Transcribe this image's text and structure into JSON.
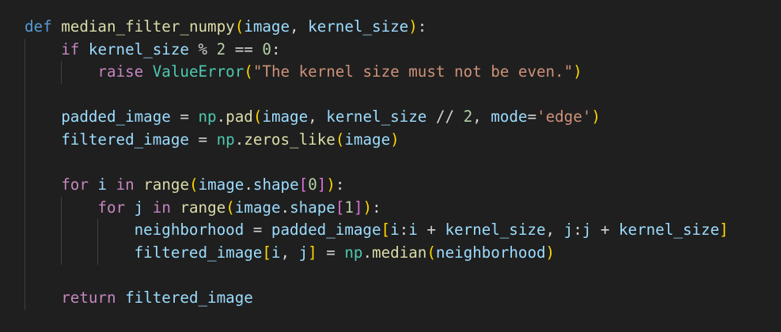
{
  "editor": {
    "language": "python",
    "theme_colors": {
      "background": "#1f1f1f",
      "keyword_def": "#569cd6",
      "keyword_control": "#c586c0",
      "function": "#dcdcaa",
      "variable": "#9cdcfe",
      "module": "#4ec9b0",
      "number": "#b5cea8",
      "string": "#ce9178",
      "bracket_level1": "#ffd700",
      "bracket_level2": "#da70d6",
      "bracket_level3": "#179fff"
    },
    "lines": [
      [
        {
          "t": "def",
          "c": "kw-def"
        },
        {
          "t": " ",
          "c": "op"
        },
        {
          "t": "median_filter_numpy",
          "c": "fn"
        },
        {
          "t": "(",
          "c": "b1"
        },
        {
          "t": "image",
          "c": "var"
        },
        {
          "t": ", ",
          "c": "op"
        },
        {
          "t": "kernel_size",
          "c": "var"
        },
        {
          "t": ")",
          "c": "b1"
        },
        {
          "t": ":",
          "c": "op"
        }
      ],
      [
        {
          "t": "    ",
          "c": "op"
        },
        {
          "t": "if",
          "c": "kw-ctl"
        },
        {
          "t": " ",
          "c": "op"
        },
        {
          "t": "kernel_size",
          "c": "var"
        },
        {
          "t": " % ",
          "c": "op"
        },
        {
          "t": "2",
          "c": "num"
        },
        {
          "t": " == ",
          "c": "op"
        },
        {
          "t": "0",
          "c": "num"
        },
        {
          "t": ":",
          "c": "op"
        }
      ],
      [
        {
          "t": "        ",
          "c": "op"
        },
        {
          "t": "raise",
          "c": "kw-ctl"
        },
        {
          "t": " ",
          "c": "op"
        },
        {
          "t": "ValueError",
          "c": "cls"
        },
        {
          "t": "(",
          "c": "b1"
        },
        {
          "t": "\"The kernel size must not be even.\"",
          "c": "str"
        },
        {
          "t": ")",
          "c": "b1"
        }
      ],
      [],
      [
        {
          "t": "    ",
          "c": "op"
        },
        {
          "t": "padded_image",
          "c": "var"
        },
        {
          "t": " = ",
          "c": "op"
        },
        {
          "t": "np",
          "c": "mod"
        },
        {
          "t": ".",
          "c": "op"
        },
        {
          "t": "pad",
          "c": "fn"
        },
        {
          "t": "(",
          "c": "b1"
        },
        {
          "t": "image",
          "c": "var"
        },
        {
          "t": ", ",
          "c": "op"
        },
        {
          "t": "kernel_size",
          "c": "var"
        },
        {
          "t": " // ",
          "c": "op"
        },
        {
          "t": "2",
          "c": "num"
        },
        {
          "t": ", ",
          "c": "op"
        },
        {
          "t": "mode",
          "c": "var"
        },
        {
          "t": "=",
          "c": "op"
        },
        {
          "t": "'edge'",
          "c": "str"
        },
        {
          "t": ")",
          "c": "b1"
        }
      ],
      [
        {
          "t": "    ",
          "c": "op"
        },
        {
          "t": "filtered_image",
          "c": "var"
        },
        {
          "t": " = ",
          "c": "op"
        },
        {
          "t": "np",
          "c": "mod"
        },
        {
          "t": ".",
          "c": "op"
        },
        {
          "t": "zeros_like",
          "c": "fn"
        },
        {
          "t": "(",
          "c": "b1"
        },
        {
          "t": "image",
          "c": "var"
        },
        {
          "t": ")",
          "c": "b1"
        }
      ],
      [],
      [
        {
          "t": "    ",
          "c": "op"
        },
        {
          "t": "for",
          "c": "kw-ctl"
        },
        {
          "t": " ",
          "c": "op"
        },
        {
          "t": "i",
          "c": "var"
        },
        {
          "t": " ",
          "c": "op"
        },
        {
          "t": "in",
          "c": "kw-ctl"
        },
        {
          "t": " ",
          "c": "op"
        },
        {
          "t": "range",
          "c": "fn"
        },
        {
          "t": "(",
          "c": "b1"
        },
        {
          "t": "image",
          "c": "var"
        },
        {
          "t": ".",
          "c": "op"
        },
        {
          "t": "shape",
          "c": "var"
        },
        {
          "t": "[",
          "c": "b2"
        },
        {
          "t": "0",
          "c": "num"
        },
        {
          "t": "]",
          "c": "b2"
        },
        {
          "t": ")",
          "c": "b1"
        },
        {
          "t": ":",
          "c": "op"
        }
      ],
      [
        {
          "t": "        ",
          "c": "op"
        },
        {
          "t": "for",
          "c": "kw-ctl"
        },
        {
          "t": " ",
          "c": "op"
        },
        {
          "t": "j",
          "c": "var"
        },
        {
          "t": " ",
          "c": "op"
        },
        {
          "t": "in",
          "c": "kw-ctl"
        },
        {
          "t": " ",
          "c": "op"
        },
        {
          "t": "range",
          "c": "fn"
        },
        {
          "t": "(",
          "c": "b1"
        },
        {
          "t": "image",
          "c": "var"
        },
        {
          "t": ".",
          "c": "op"
        },
        {
          "t": "shape",
          "c": "var"
        },
        {
          "t": "[",
          "c": "b2"
        },
        {
          "t": "1",
          "c": "num"
        },
        {
          "t": "]",
          "c": "b2"
        },
        {
          "t": ")",
          "c": "b1"
        },
        {
          "t": ":",
          "c": "op"
        }
      ],
      [
        {
          "t": "            ",
          "c": "op"
        },
        {
          "t": "neighborhood",
          "c": "var"
        },
        {
          "t": " = ",
          "c": "op"
        },
        {
          "t": "padded_image",
          "c": "var"
        },
        {
          "t": "[",
          "c": "b1"
        },
        {
          "t": "i",
          "c": "var"
        },
        {
          "t": ":",
          "c": "op"
        },
        {
          "t": "i",
          "c": "var"
        },
        {
          "t": " + ",
          "c": "op"
        },
        {
          "t": "kernel_size",
          "c": "var"
        },
        {
          "t": ", ",
          "c": "op"
        },
        {
          "t": "j",
          "c": "var"
        },
        {
          "t": ":",
          "c": "op"
        },
        {
          "t": "j",
          "c": "var"
        },
        {
          "t": " + ",
          "c": "op"
        },
        {
          "t": "kernel_size",
          "c": "var"
        },
        {
          "t": "]",
          "c": "b1"
        }
      ],
      [
        {
          "t": "            ",
          "c": "op"
        },
        {
          "t": "filtered_image",
          "c": "var"
        },
        {
          "t": "[",
          "c": "b1"
        },
        {
          "t": "i",
          "c": "var"
        },
        {
          "t": ", ",
          "c": "op"
        },
        {
          "t": "j",
          "c": "var"
        },
        {
          "t": "]",
          "c": "b1"
        },
        {
          "t": " = ",
          "c": "op"
        },
        {
          "t": "np",
          "c": "mod"
        },
        {
          "t": ".",
          "c": "op"
        },
        {
          "t": "median",
          "c": "fn"
        },
        {
          "t": "(",
          "c": "b1"
        },
        {
          "t": "neighborhood",
          "c": "var"
        },
        {
          "t": ")",
          "c": "b1"
        }
      ],
      [],
      [
        {
          "t": "    ",
          "c": "op"
        },
        {
          "t": "return",
          "c": "kw-ctl"
        },
        {
          "t": " ",
          "c": "op"
        },
        {
          "t": "filtered_image",
          "c": "var"
        }
      ]
    ]
  }
}
